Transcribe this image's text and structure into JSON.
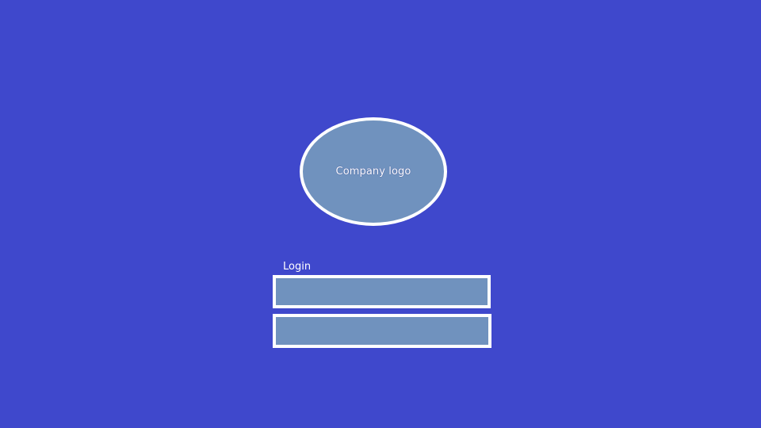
{
  "logo": {
    "text": "Company logo"
  },
  "login": {
    "label": "Login",
    "field_1": {
      "value": "",
      "placeholder": ""
    },
    "field_2": {
      "value": "",
      "placeholder": ""
    }
  },
  "colors": {
    "background": "#3f48cc",
    "field_fill": "#7092be",
    "border": "#ffffff",
    "text": "#ffffff"
  }
}
